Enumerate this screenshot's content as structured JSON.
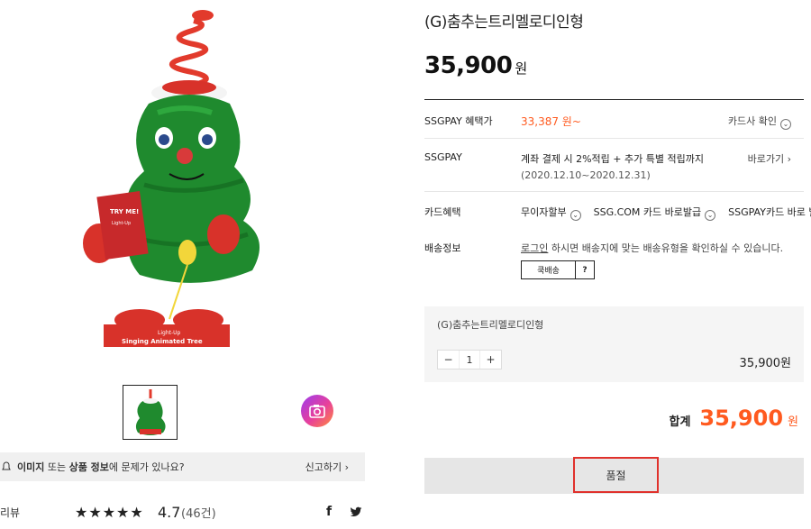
{
  "product": {
    "title": "(G)춤추는트리멜로디인형",
    "price": "35,900",
    "price_unit": "원",
    "box_line1": "Light-Up",
    "box_line2": "Singing Animated Tree",
    "tag_line1": "TRY ME!",
    "tag_line2": "Light-Up"
  },
  "gallery": {
    "report_msg_pre": "이미지",
    "report_msg_mid1": " 또는 ",
    "report_msg_bold2": "상품 정보",
    "report_msg_post": "에 문제가 있나요?",
    "report_link": "신고하기",
    "report_link_arrow": "›"
  },
  "review": {
    "label": "리뷰",
    "stars": "★★★★★",
    "rating": "4.7",
    "count": "(46건)"
  },
  "info": {
    "ssgpay_benefit_label": "SSGPAY 혜택가",
    "ssgpay_benefit_price": "33,387 원~",
    "card_check_link": "카드사 확인",
    "ssgpay_label": "SSGPAY",
    "ssgpay_desc": "계좌 결제 시 2%적립 + 추가 특별 적립까지",
    "ssgpay_period": "(2020.12.10~2020.12.31)",
    "ssgpay_go_link": "바로가기",
    "ssgpay_go_arrow": "›",
    "card_label": "카드혜택",
    "card_options": [
      "무이자할부",
      "SSG.COM 카드 바로발급",
      "SSGPAY카드 바로 발급"
    ],
    "ship_label": "배송정보",
    "ship_login": "로그인",
    "ship_msg": " 하시면 배송지에 맞는 배송유형을 확인하실 수 있습니다.",
    "ship_btn": "쿡배송",
    "ship_help": "?"
  },
  "option": {
    "name": "(G)춤추는트리멜로디인형",
    "minus": "−",
    "qty": "1",
    "plus": "+",
    "price": "35,900원"
  },
  "total": {
    "label": "합계",
    "value": "35,900",
    "unit": "원"
  },
  "soldout": {
    "label": "품절"
  },
  "colors": {
    "accent": "#ff5a1f",
    "soldout_border": "#e0312c",
    "tree": "#1f8a2e"
  },
  "icons": {
    "chevron": "circle-chevron-down-icon",
    "lens": "camera-lens-icon",
    "facebook": "facebook-icon",
    "twitter": "twitter-icon"
  }
}
